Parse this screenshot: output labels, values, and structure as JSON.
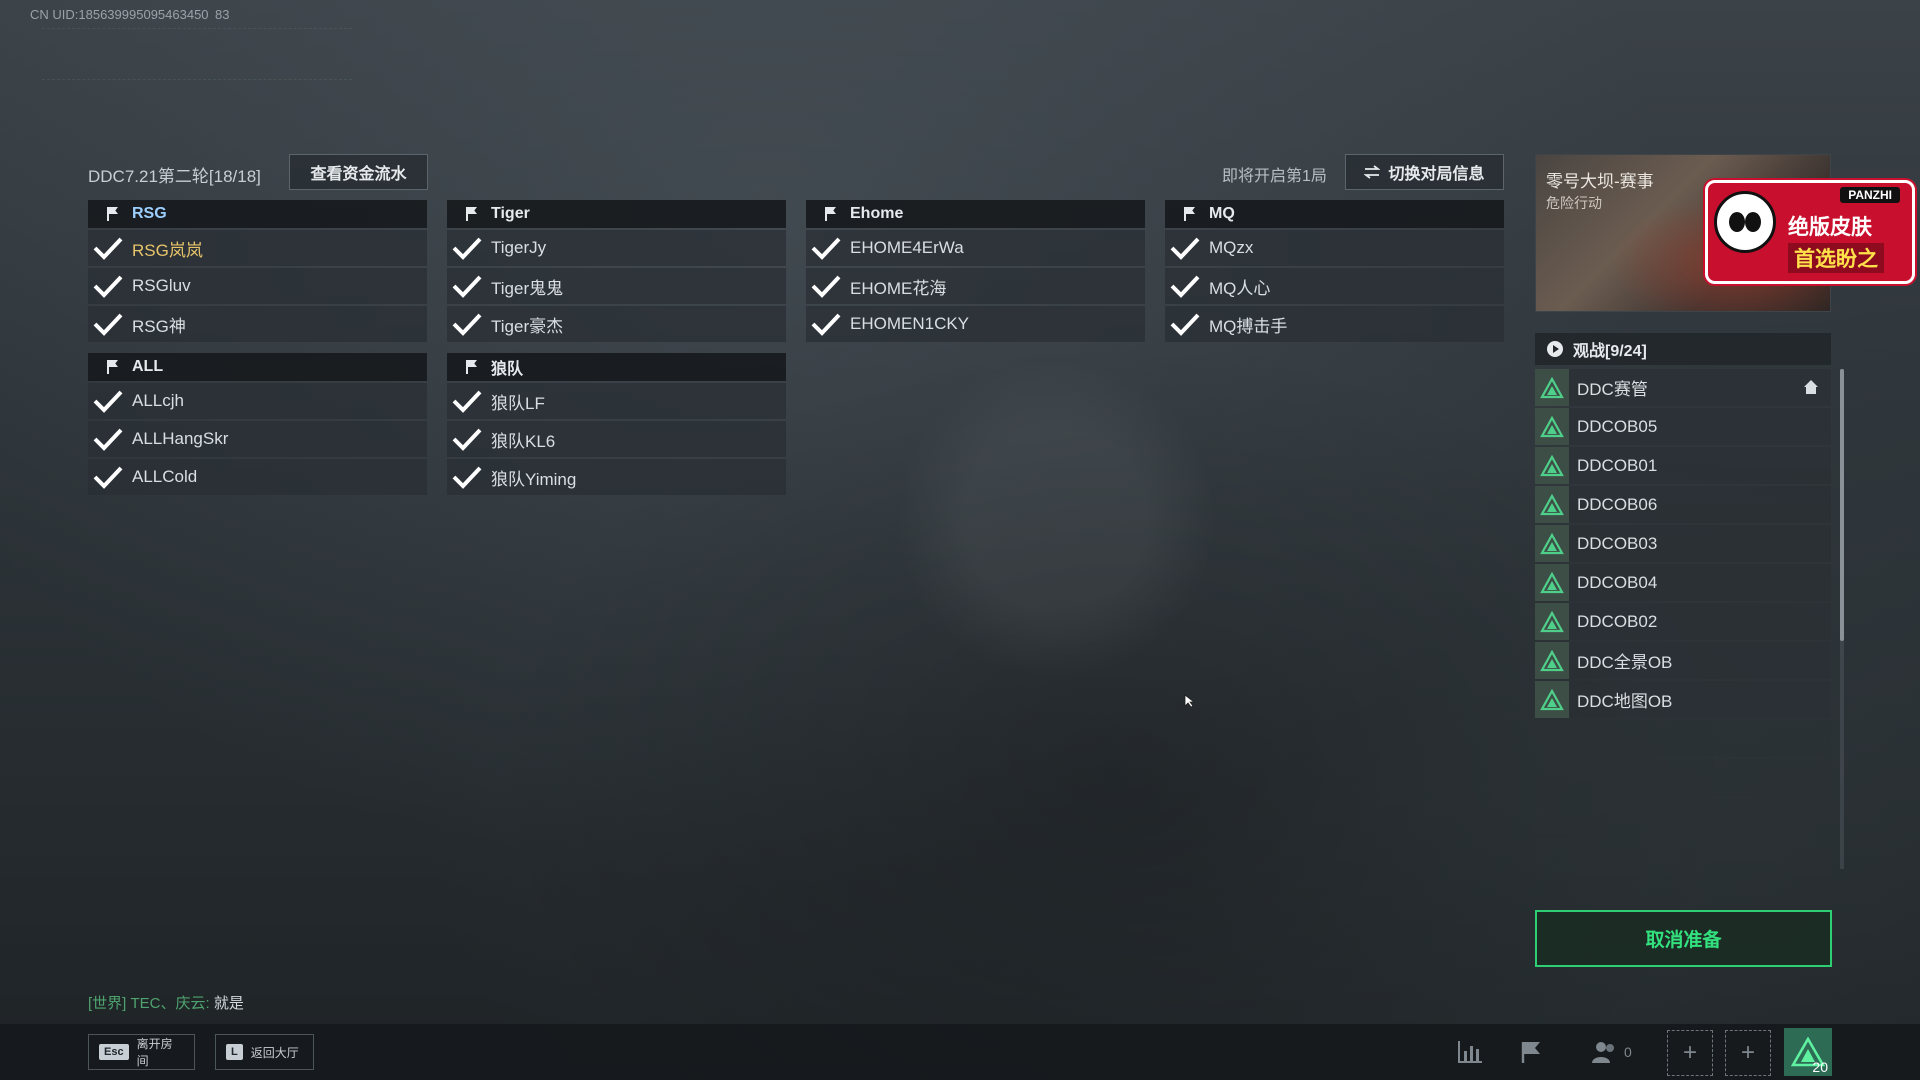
{
  "uid": "CN UID:185639995095463450 83",
  "room": {
    "title": "DDC7.21第二轮[18/18]",
    "funds_button": "查看资金流水",
    "round_status": "即将开启第1局",
    "switch_button": "切换对局信息"
  },
  "teams": [
    {
      "name": "RSG",
      "members": [
        "RSG岚岚",
        "RSGluv",
        "RSG神"
      ]
    },
    {
      "name": "Tiger",
      "members": [
        "TigerJy",
        "Tiger鬼鬼",
        "Tiger豪杰"
      ]
    },
    {
      "name": "Ehome",
      "members": [
        "EHOME4ErWa",
        "EHOME花海",
        "EHOMEN1CKY"
      ]
    },
    {
      "name": "MQ",
      "members": [
        "MQzx",
        "MQ人心",
        "MQ搏击手"
      ]
    },
    {
      "name": "ALL",
      "members": [
        "ALLcjh",
        "ALLHangSkr",
        "ALLCold"
      ]
    },
    {
      "name": "狼队",
      "members": [
        "狼队LF",
        "狼队KL6",
        "狼队Yiming"
      ]
    }
  ],
  "banner": {
    "title": "零号大坝-赛事",
    "subtitle": "危险行动"
  },
  "ad": {
    "brand": "PANZHI",
    "line1": "绝版皮肤",
    "line2": "首选盼之"
  },
  "spectators": {
    "header": "观战[9/24]",
    "list": [
      "DDC赛管",
      "DDCOB05",
      "DDCOB01",
      "DDCOB06",
      "DDCOB03",
      "DDCOB04",
      "DDCOB02",
      "DDC全景OB",
      "DDC地图OB"
    ]
  },
  "ready_button": "取消准备",
  "chat": {
    "channel": "[世界]",
    "sender": "TEC、庆云:",
    "message": "就是"
  },
  "bottom": {
    "esc_key": "Esc",
    "esc_label": "离开房间",
    "l_key": "L",
    "l_label": "返回大厅",
    "friends_count": "0",
    "level": "20"
  },
  "colors": {
    "ready_green": "#2ecf72",
    "self_name_gold": "#e8c46a",
    "team_accent": "#9ccfff"
  }
}
